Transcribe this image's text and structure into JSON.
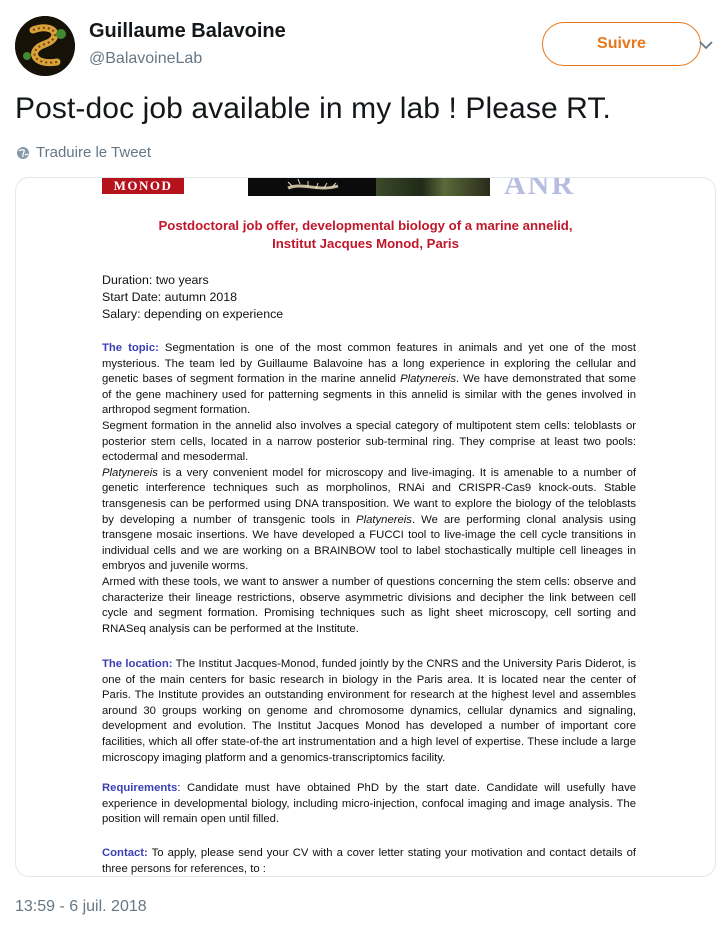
{
  "user": {
    "name": "Guillaume Balavoine",
    "handle": "@BalavoineLab"
  },
  "follow_button": {
    "label": "Suivre"
  },
  "tweet": {
    "text": "Post-doc job available in my lab ! Please RT.",
    "translate_label": "Traduire le Tweet",
    "timestamp": "13:59 - 6 juil. 2018"
  },
  "document": {
    "logo_text": "MONOD",
    "partner_logo": "ANR",
    "title_line1": "Postdoctoral job offer, developmental biology of a marine annelid,",
    "title_line2": "Institut Jacques Monod, Paris",
    "duration": "Duration: two years",
    "start_date": "Start Date: autumn 2018",
    "salary": "Salary: depending on experience",
    "topic_head": "The topic:",
    "topic_p1": " Segmentation is one of the most common features in animals and yet one of the most mysterious. The team led by Guillaume Balavoine has a long experience in exploring the cellular and genetic bases of segment formation in the marine annelid ",
    "topic_p1_em": "Platynereis",
    "topic_p1_end": ". We have demonstrated that some of the gene machinery used for patterning segments in this annelid is similar with the genes involved in arthropod segment formation.",
    "topic_p2": "Segment formation in the annelid also involves a special category of multipotent stem cells: teloblasts or posterior stem cells, located in a narrow posterior sub-terminal ring. They comprise at least two pools: ectodermal and mesodermal.",
    "topic_p3_em": "Platynereis",
    "topic_p3": " is a very convenient model for microscopy and live-imaging. It is amenable to a number of genetic interference techniques such as morpholinos, RNAi and CRISPR-Cas9 knock-outs. Stable transgenesis can be performed using DNA transposition. We want to explore the biology of the teloblasts by developing a number of transgenic tools in ",
    "topic_p3_em2": "Platynereis",
    "topic_p3_end": ". We are performing clonal analysis using transgene mosaic insertions. We have developed a FUCCI tool to live-image the cell cycle transitions in individual cells and we are working on a BRAINBOW tool to label stochastically multiple cell lineages in embryos and juvenile worms.",
    "topic_p4": "Armed with these tools, we want to answer a number of questions concerning the stem cells: observe and characterize their lineage restrictions, observe asymmetric divisions and decipher the link between cell cycle and segment formation. Promising techniques such as light sheet microscopy, cell sorting and RNASeq analysis can be performed at the Institute.",
    "location_head": "The location:",
    "location_text": " The Institut Jacques-Monod, funded jointly by the CNRS and the University Paris Diderot, is one of the main centers for basic research in biology in the Paris area. It is located near the center of Paris. The Institute provides an outstanding environment for research at the highest level and assembles around 30 groups working on genome and chromosome dynamics, cellular dynamics and signaling, development and evolution. The Institut Jacques Monod has developed a number of important core facilities, which all offer state-of-the art instrumentation and a high level of expertise. These include a large microscopy imaging platform and a genomics-transcriptomics facility.",
    "requirements_head": "Requirements",
    "requirements_text": ": Candidate must have obtained PhD by the start date. Candidate will usefully have experience in developmental biology, including micro-injection, confocal imaging and image analysis. The position will remain open until filled.",
    "contact_head": "Contact:",
    "contact_text": " To apply, please send your CV with a cover letter stating your motivation and contact details of three persons for references, to :"
  },
  "colors": {
    "accent": "#e8761b",
    "title_red": "#c0172a",
    "heading_blue": "#3b3fb3",
    "muted": "#657786"
  }
}
